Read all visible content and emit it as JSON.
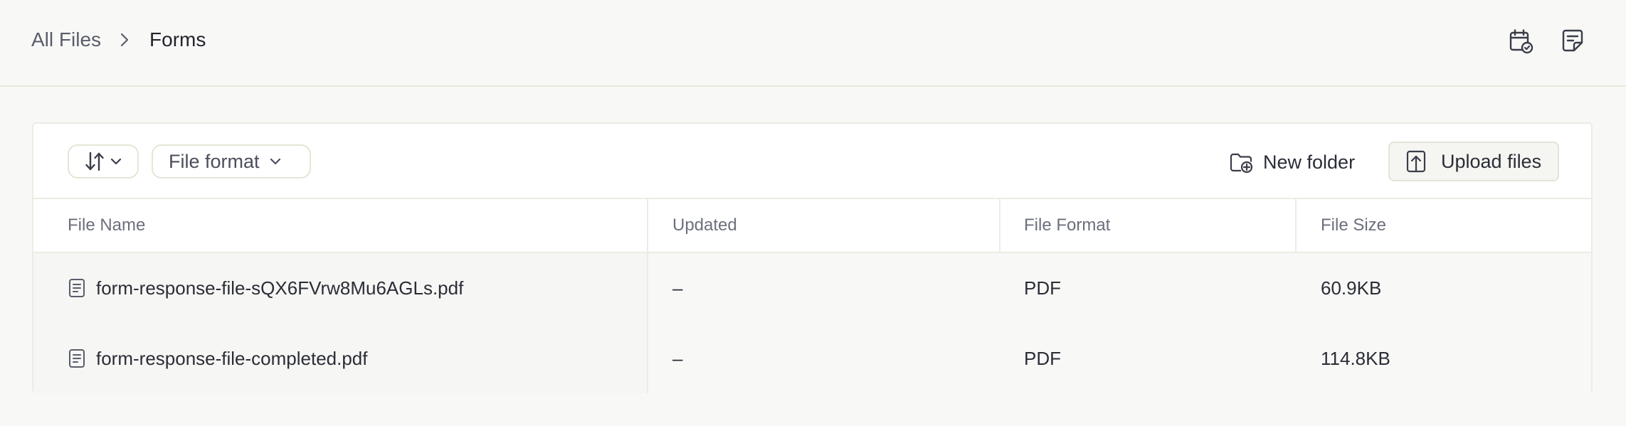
{
  "breadcrumb": {
    "root": "All Files",
    "current": "Forms"
  },
  "header_icons": [
    "calendar-check-icon",
    "sticky-note-icon"
  ],
  "toolbar": {
    "sort_icon": "sort-arrows-icon",
    "file_format_label": "File format",
    "new_folder_label": "New folder",
    "upload_label": "Upload files"
  },
  "table": {
    "columns": [
      "File Name",
      "Updated",
      "File Format",
      "File Size"
    ],
    "rows": [
      {
        "name": "form-response-file-sQX6FVrw8Mu6AGLs.pdf",
        "updated": "–",
        "format": "PDF",
        "size": "60.9KB"
      },
      {
        "name": "form-response-file-completed.pdf",
        "updated": "–",
        "format": "PDF",
        "size": "114.8KB"
      }
    ]
  },
  "colors": {
    "background": "#f8f8f6",
    "panel": "#ffffff",
    "border": "#ebede3",
    "text": "#2b2d36",
    "muted": "#6c6f7c"
  }
}
